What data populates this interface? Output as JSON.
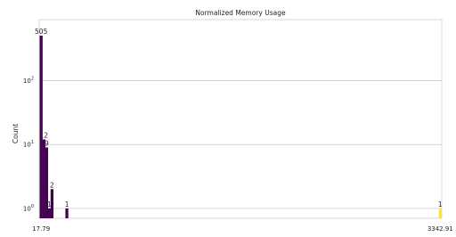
{
  "chart_data": {
    "type": "bar",
    "title": "Normalized Memory Usage",
    "xlabel": "",
    "ylabel": "Count",
    "yscale": "log",
    "ylim": [
      0.7,
      900
    ],
    "xlim": [
      17.79,
      3342.91
    ],
    "grid": "horizontal",
    "x_tick_labels": [
      "17.79",
      "3342.91"
    ],
    "y_ticks": [
      {
        "value": 1,
        "base": "10",
        "exp": "0"
      },
      {
        "value": 10,
        "base": "10",
        "exp": "1"
      },
      {
        "value": 100,
        "base": "10",
        "exp": "2"
      }
    ],
    "bars": [
      {
        "x": 17.8,
        "value": 505,
        "label": "505",
        "color": "#440154"
      },
      {
        "x": 40.7,
        "value": 12,
        "label": "12",
        "color": "#440154"
      },
      {
        "x": 63.6,
        "value": 9,
        "label": "9",
        "color": "#440154"
      },
      {
        "x": 86.4,
        "value": 1,
        "label": "1",
        "color": "#440154"
      },
      {
        "x": 108.4,
        "value": 2,
        "label": "2",
        "color": "#440154"
      },
      {
        "x": 232.1,
        "value": 1,
        "label": "1",
        "color": "#440154"
      },
      {
        "x": 3342.9,
        "value": 1,
        "label": "1",
        "color": "#fde725"
      }
    ]
  }
}
